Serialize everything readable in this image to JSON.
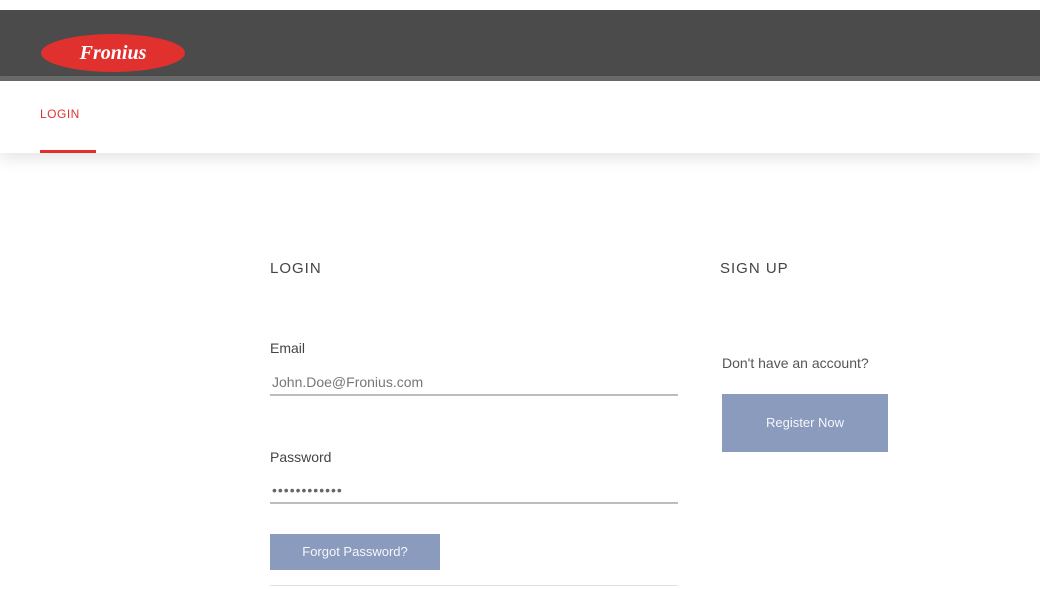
{
  "brand": {
    "logo_text": "Fronius",
    "logo_color": "#e0312e",
    "header_color": "#4b4b4b"
  },
  "nav": {
    "active_tab": "LOGIN"
  },
  "login": {
    "title": "LOGIN",
    "email_label": "Email",
    "email_value": "John.Doe@Fronius.com",
    "password_label": "Password",
    "password_value": "••••••••••••",
    "forgot_button": "Forgot Password?"
  },
  "signup": {
    "title": "SIGN UP",
    "prompt": "Don't have an account?",
    "register_button": "Register Now"
  },
  "colors": {
    "accent": "#e0312e",
    "button": "#8b9bbd"
  }
}
